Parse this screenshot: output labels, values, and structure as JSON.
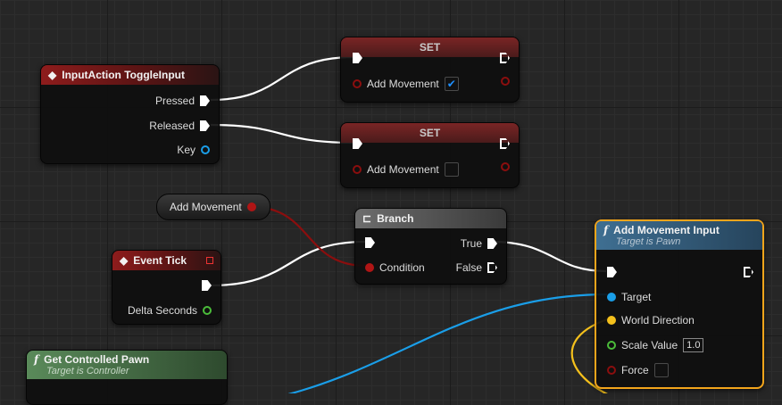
{
  "nodes": {
    "input_action": {
      "title": "InputAction ToggleInput",
      "pressed": "Pressed",
      "released": "Released",
      "key": "Key"
    },
    "set1": {
      "title": "SET",
      "var": "Add Movement",
      "checked": true
    },
    "set2": {
      "title": "SET",
      "var": "Add Movement",
      "checked": false
    },
    "getter": {
      "label": "Add Movement"
    },
    "branch": {
      "title": "Branch",
      "condition": "Condition",
      "true_label": "True",
      "false_label": "False"
    },
    "event_tick": {
      "title": "Event Tick",
      "delta": "Delta Seconds"
    },
    "get_pawn": {
      "title": "Get Controlled Pawn",
      "subtitle": "Target is Controller"
    },
    "add_movement_input": {
      "title": "Add Movement Input",
      "subtitle": "Target is Pawn",
      "target": "Target",
      "world_direction": "World Direction",
      "scale_value": "Scale Value",
      "scale_value_default": "1.0",
      "force": "Force"
    }
  },
  "glyphs": {
    "function": "f",
    "check": "✔"
  },
  "colors": {
    "exec": "#ffffff",
    "bool_pin": "#8b0e0e",
    "object_pin": "#1a9ee8",
    "vector_pin": "#f4c01c",
    "float_pin": "#4bbd3a",
    "selected_outline": "#f3a51b"
  }
}
